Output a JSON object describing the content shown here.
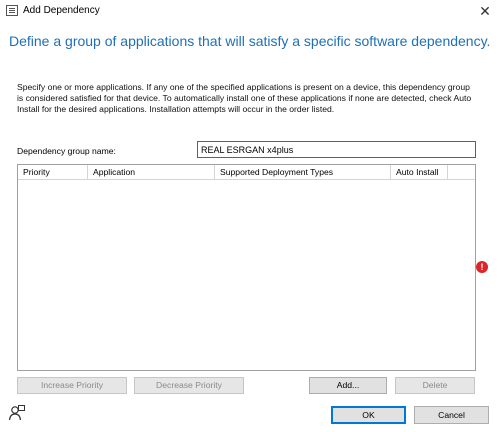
{
  "window": {
    "title": "Add Dependency",
    "close_glyph": "✕"
  },
  "headline": "Define a group of applications that will satisfy a specific software dependency.",
  "description": "Specify one or more applications. If any one of the specified applications is present on a device, this dependency group is considered satisfied for that device. To automatically install one of these applications if none are detected, check Auto Install for the desired applications. Installation attempts will occur in the order listed.",
  "group_name": {
    "label": "Dependency group name:",
    "value": "REAL ESRGAN x4plus"
  },
  "grid": {
    "columns": [
      "Priority",
      "Application",
      "Supported Deployment Types",
      "Auto Install"
    ],
    "rows": []
  },
  "validation": {
    "icon": "error-icon",
    "glyph": "!",
    "color": "#d9262c"
  },
  "buttons": {
    "increase_priority": "Increase Priority",
    "decrease_priority": "Decrease Priority",
    "add": "Add...",
    "delete": "Delete",
    "ok": "OK",
    "cancel": "Cancel"
  },
  "icons": {
    "app": "list-window-icon",
    "user": "user-feedback-icon"
  },
  "colors": {
    "headline": "#1f6fb5",
    "input_focus_border": "#1e6ec8",
    "default_button_border": "#0078d7"
  }
}
